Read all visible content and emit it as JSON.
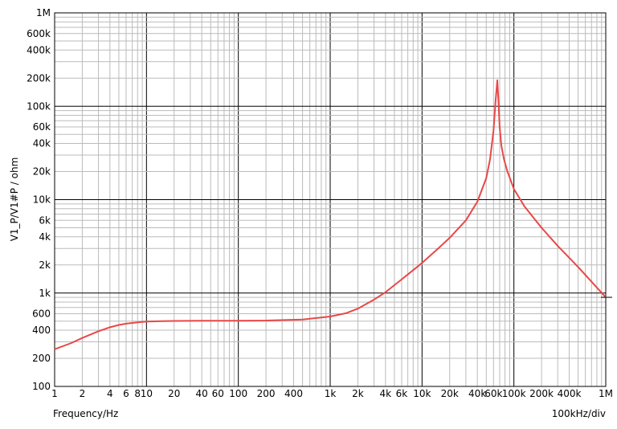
{
  "chart_data": {
    "type": "line",
    "title": "",
    "xlabel": "Frequency/Hz",
    "ylabel": "V1_P/V1#P / ohm",
    "x_scale_note": "100kHz/div",
    "x_scale": "log",
    "y_scale": "log",
    "xlim": [
      1,
      1000000
    ],
    "ylim": [
      100,
      1000000
    ],
    "grid": true,
    "x_ticks": [
      {
        "v": 1,
        "label": "1"
      },
      {
        "v": 2,
        "label": "2"
      },
      {
        "v": 4,
        "label": "4"
      },
      {
        "v": 6,
        "label": "6"
      },
      {
        "v": 8,
        "label": "8"
      },
      {
        "v": 10,
        "label": "10"
      },
      {
        "v": 20,
        "label": "20"
      },
      {
        "v": 40,
        "label": "40"
      },
      {
        "v": 60,
        "label": "60"
      },
      {
        "v": 100,
        "label": "100"
      },
      {
        "v": 200,
        "label": "200"
      },
      {
        "v": 400,
        "label": "400"
      },
      {
        "v": 1000,
        "label": "1k"
      },
      {
        "v": 2000,
        "label": "2k"
      },
      {
        "v": 4000,
        "label": "4k"
      },
      {
        "v": 6000,
        "label": "6k"
      },
      {
        "v": 10000,
        "label": "10k"
      },
      {
        "v": 20000,
        "label": "20k"
      },
      {
        "v": 40000,
        "label": "40k"
      },
      {
        "v": 60000,
        "label": "60k"
      },
      {
        "v": 100000,
        "label": "100k"
      },
      {
        "v": 200000,
        "label": "200k"
      },
      {
        "v": 400000,
        "label": "400k"
      },
      {
        "v": 1000000,
        "label": "1M"
      }
    ],
    "y_ticks": [
      {
        "v": 100,
        "label": "100"
      },
      {
        "v": 200,
        "label": "200"
      },
      {
        "v": 400,
        "label": "400"
      },
      {
        "v": 600,
        "label": "600"
      },
      {
        "v": 1000,
        "label": "1k"
      },
      {
        "v": 2000,
        "label": "2k"
      },
      {
        "v": 4000,
        "label": "4k"
      },
      {
        "v": 6000,
        "label": "6k"
      },
      {
        "v": 10000,
        "label": "10k"
      },
      {
        "v": 20000,
        "label": "20k"
      },
      {
        "v": 40000,
        "label": "40k"
      },
      {
        "v": 60000,
        "label": "60k"
      },
      {
        "v": 100000,
        "label": "100k"
      },
      {
        "v": 200000,
        "label": "200k"
      },
      {
        "v": 400000,
        "label": "400k"
      },
      {
        "v": 600000,
        "label": "600k"
      },
      {
        "v": 1000000,
        "label": "1M"
      }
    ],
    "series": [
      {
        "color": "#e84848",
        "x": [
          1,
          1.5,
          2,
          3,
          4,
          5,
          6,
          8,
          10,
          15,
          20,
          40,
          100,
          200,
          500,
          1000,
          1500,
          2000,
          3000,
          4000,
          6000,
          10000,
          15000,
          20000,
          30000,
          40000,
          50000,
          55000,
          60000,
          63000,
          66000,
          68000,
          70000,
          73000,
          78000,
          85000,
          100000,
          130000,
          200000,
          300000,
          500000,
          1000000
        ],
        "values": [
          250,
          290,
          330,
          390,
          430,
          455,
          470,
          485,
          495,
          500,
          502,
          505,
          505,
          507,
          520,
          560,
          610,
          680,
          850,
          1020,
          1400,
          2100,
          3000,
          3900,
          6000,
          9500,
          17000,
          27000,
          55000,
          110000,
          190000,
          110000,
          60000,
          38000,
          27000,
          20000,
          13000,
          8500,
          5000,
          3200,
          1900,
          900
        ]
      }
    ]
  }
}
